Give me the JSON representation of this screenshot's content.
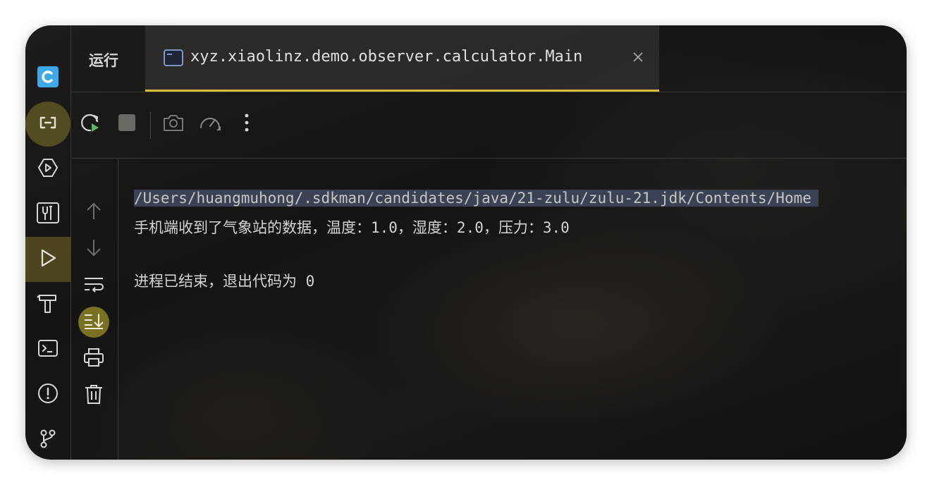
{
  "header": {
    "title": "运行",
    "tab": {
      "label": "xyz.xiaolinz.demo.observer.calculator.Main"
    }
  },
  "activity_bar": {
    "items": [
      {
        "icon": "app-logo-icon"
      },
      {
        "icon": "code-with-me-icon",
        "highlighted": true
      },
      {
        "icon": "services-icon"
      },
      {
        "icon": "build-tools-icon"
      },
      {
        "icon": "run-icon",
        "active": true
      },
      {
        "icon": "build-hammer-icon"
      },
      {
        "icon": "terminal-icon"
      },
      {
        "icon": "problems-icon"
      },
      {
        "icon": "git-icon"
      }
    ]
  },
  "toolbar": {
    "buttons": [
      "rerun-icon",
      "stop-icon",
      "screenshot-icon",
      "profiler-icon",
      "more-icon"
    ]
  },
  "console_gutter": {
    "buttons": [
      "up-arrow-icon",
      "down-arrow-icon",
      "soft-wrap-icon",
      "scroll-to-end-icon",
      "print-icon",
      "trash-icon"
    ]
  },
  "console": {
    "lines": [
      "/Users/huangmuhong/.sdkman/candidates/java/21-zulu/zulu-21.jdk/Contents/Home",
      "手机端收到了气象站的数据，温度：1.0，湿度：2.0，压力：3.0",
      "",
      "进程已结束，退出代码为 0"
    ]
  },
  "colors": {
    "accent": "#d4c03a",
    "highlight": "#8c8028",
    "selection": "#3b4255",
    "run_green": "#5fb865"
  }
}
